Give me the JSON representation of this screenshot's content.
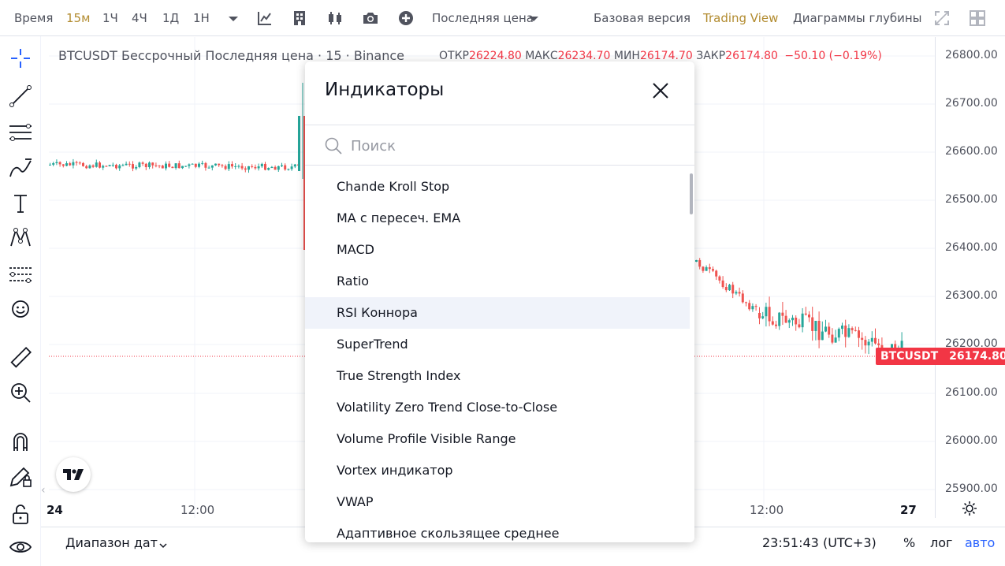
{
  "toolbar": {
    "time_label": "Время",
    "intervals": [
      "15м",
      "1Ч",
      "4Ч",
      "1Д",
      "1Н"
    ],
    "active_interval": "15м",
    "price_type": "Последняя цена",
    "base_version": "Базовая версия",
    "trading_view": "Trading View",
    "depth_charts": "Диаграммы глубины",
    "accent_color": "#b28b2f"
  },
  "legend": {
    "title": "BTCUSDT Бессрочный Последняя цена · 15 · Binance",
    "open_label": "ОТКР",
    "open": "26224.80",
    "high_label": "МАКС",
    "high": "26234.70",
    "low_label": "МИН",
    "low": "26174.70",
    "close_label": "ЗАКР",
    "close": "26174.80",
    "change": "−50.10 (−0.19%)"
  },
  "price_scale": [
    "26800.00",
    "26700.00",
    "26600.00",
    "26500.00",
    "26400.00",
    "26300.00",
    "26200.00",
    "26100.00",
    "26000.00",
    "25900.00"
  ],
  "price_tag": {
    "symbol": "BTCUSDT",
    "value": "26174.80",
    "color": "#f23645"
  },
  "time_scale": {
    "left_partial": "24",
    "t1": "12:00",
    "t2": "12:00",
    "t3": "27"
  },
  "bottom": {
    "date_range": "Диапазон дат",
    "clock": "23:51:43 (UTC+3)",
    "percent": "%",
    "log": "лог",
    "auto": "авто"
  },
  "modal": {
    "title": "Индикаторы",
    "search_placeholder": "Поиск",
    "items": [
      "Chande Kroll Stop",
      "MA с пересеч. EMA",
      "MACD",
      "Ratio",
      "RSI Коннора",
      "SuperTrend",
      "True Strength Index",
      "Volatility Zero Trend Close-to-Close",
      "Volume Profile Visible Range",
      "Vortex индикатор",
      "VWAP",
      "Адаптивное скользящее среднее"
    ],
    "hovered_index": 4
  },
  "colors": {
    "up": "#26a69a",
    "down": "#ef5350"
  },
  "icons": {
    "left_toolbar": [
      "crosshair-icon",
      "trend-line-icon",
      "fib-icon",
      "brush-icon",
      "text-icon",
      "pattern-icon",
      "forecast-icon",
      "emoji-icon",
      "ruler-icon",
      "zoom-in-icon",
      "magnet-icon",
      "lock-drawing-icon",
      "unlock-icon",
      "eye-icon"
    ]
  }
}
